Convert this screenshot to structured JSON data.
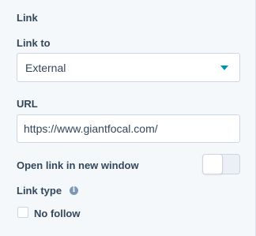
{
  "link_section": {
    "title": "Link",
    "link_to": {
      "label": "Link to",
      "selected": "External"
    },
    "url": {
      "label": "URL",
      "value": "https://www.giantfocal.com/"
    },
    "open_new_window": {
      "label": "Open link in new window",
      "enabled": false
    },
    "link_type": {
      "label": "Link type",
      "info_icon": "info-icon"
    },
    "no_follow": {
      "label": "No follow",
      "checked": false
    }
  },
  "colors": {
    "text": "#33475b",
    "accent": "#0091ae",
    "border": "#cbd6e2",
    "background": "#f5f8fa"
  }
}
